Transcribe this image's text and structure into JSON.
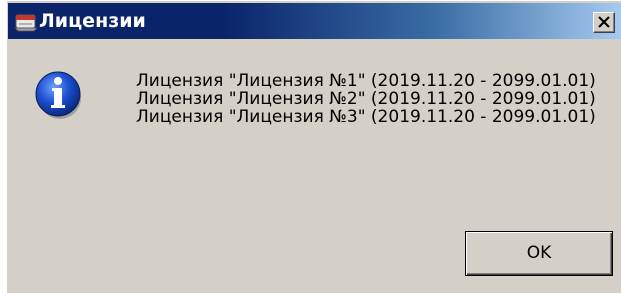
{
  "window": {
    "title": "Лицензии",
    "icons": {
      "app": "app-window-icon",
      "close": "close-icon",
      "message": "information-icon"
    },
    "colors": {
      "titlebar_start": "#0a246a",
      "titlebar_end": "#a6caf0",
      "dialog_background": "#d4d0c8",
      "info_icon_blue": "#1a4fd0"
    }
  },
  "message": {
    "lines": [
      "Лицензия \"Лицензия №1\" (2019.11.20 - 2099.01.01)",
      "Лицензия \"Лицензия №2\" (2019.11.20 - 2099.01.01)",
      "Лицензия \"Лицензия №3\" (2019.11.20 - 2099.01.01)"
    ]
  },
  "buttons": {
    "ok_label": "OK"
  }
}
